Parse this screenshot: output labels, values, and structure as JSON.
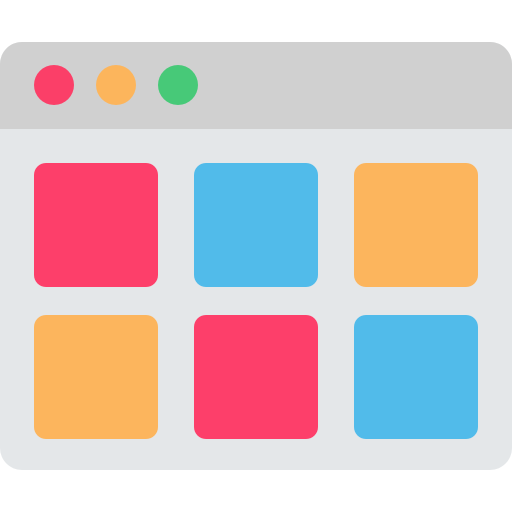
{
  "window": {
    "controls": [
      {
        "name": "close-dot",
        "icon": "red-circle",
        "color": "#fb3f68"
      },
      {
        "name": "minimize-dot",
        "icon": "yellow-circle",
        "color": "#fcb55c"
      },
      {
        "name": "maximize-dot",
        "icon": "green-circle",
        "color": "#47c978"
      }
    ],
    "titlebar_color": "#d0d0d0",
    "content_color": "#e4e7e9"
  },
  "grid": {
    "rows": [
      [
        {
          "color": "#fd3f6a"
        },
        {
          "color": "#51bbea"
        },
        {
          "color": "#fcb55d"
        }
      ],
      [
        {
          "color": "#fcb55d"
        },
        {
          "color": "#fd3f6a"
        },
        {
          "color": "#51bbea"
        }
      ]
    ]
  }
}
